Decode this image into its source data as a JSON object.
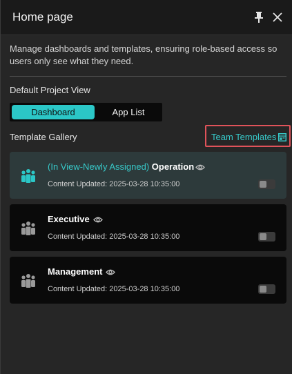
{
  "header": {
    "title": "Home page",
    "pin_icon": "pin-icon",
    "close_icon": "close-icon"
  },
  "description": "Manage dashboards and templates, ensuring role-based access so users only see what they need.",
  "default_view": {
    "label": "Default Project View",
    "options": [
      "Dashboard",
      "App List"
    ],
    "selected": "Dashboard"
  },
  "gallery": {
    "label": "Template Gallery",
    "team_templates_label": "Team Templates",
    "team_templates_icon": "template-icon"
  },
  "templates": [
    {
      "prefix": "(In View-Newly Assigned) ",
      "name": "Operation",
      "updated": "Content Updated: 2025-03-28 10:35:00",
      "selected": true,
      "enabled": false
    },
    {
      "prefix": "",
      "name": "Executive",
      "updated": "Content Updated: 2025-03-28 10:35:00",
      "selected": false,
      "enabled": false
    },
    {
      "prefix": "",
      "name": "Management",
      "updated": "Content Updated: 2025-03-28 10:35:00",
      "selected": false,
      "enabled": false
    }
  ],
  "colors": {
    "accent": "#2bc7c7",
    "highlight_border": "#e0535a",
    "selected_card": "#2d3a3b"
  }
}
